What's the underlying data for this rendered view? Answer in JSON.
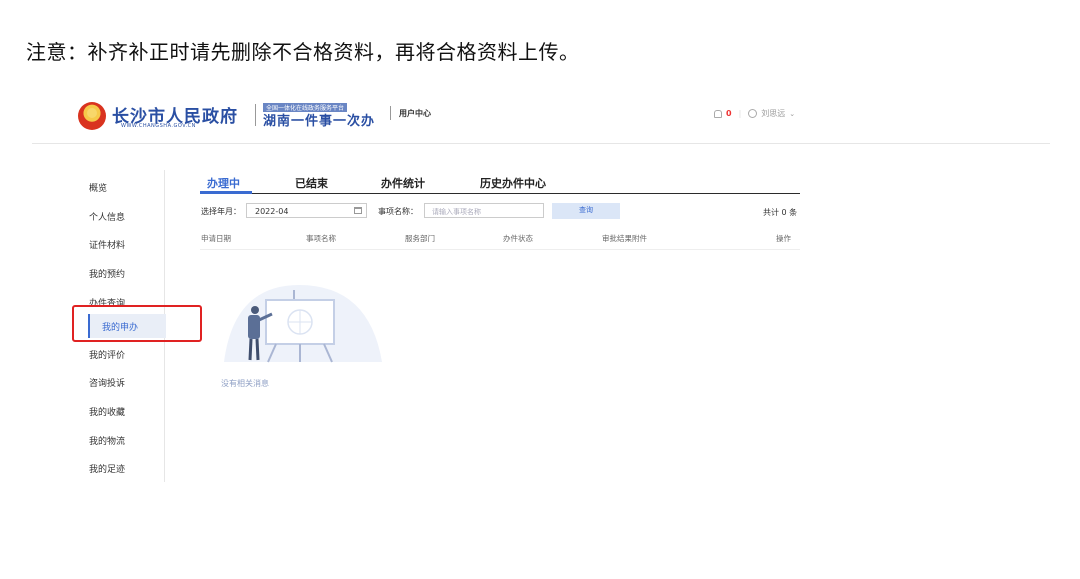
{
  "notice": "注意：补齐补正时请先删除不合格资料，再将合格资料上传。",
  "header": {
    "logo_title": "长沙市人民政府",
    "logo_url": "WWW.CHANGSHA.GOV.CN",
    "brand_top": "全国一体化在线政务服务平台",
    "brand_main": "湖南一件事一次办",
    "user_center": "用户中心",
    "notification_count": "0",
    "user_name": "刘思远",
    "icons": [
      "emblem-icon",
      "bell-icon",
      "user-icon",
      "chevron-down-icon"
    ]
  },
  "sidebar": {
    "items": [
      {
        "label": "概览"
      },
      {
        "label": "个人信息"
      },
      {
        "label": "证件材料"
      },
      {
        "label": "我的预约"
      },
      {
        "label": "办件查询"
      },
      {
        "label": "我的申办"
      },
      {
        "label": "我的评价"
      },
      {
        "label": "咨询投诉"
      },
      {
        "label": "我的收藏"
      },
      {
        "label": "我的物流"
      },
      {
        "label": "我的足迹"
      }
    ],
    "active": "我的申办",
    "highlight_color": "#e02222",
    "accent_color": "#3a6bd1"
  },
  "tabs": [
    {
      "label": "办理中",
      "active": true
    },
    {
      "label": "已结束",
      "active": false
    },
    {
      "label": "办件统计",
      "active": false
    },
    {
      "label": "历史办件中心",
      "active": false
    }
  ],
  "filters": {
    "date_label": "选择年月：",
    "date_value": "2022-04",
    "name_label": "事项名称：",
    "name_placeholder": "请输入事项名称",
    "query_button": "查询",
    "total": "共计 0 条"
  },
  "table": {
    "columns": [
      "申请日期",
      "事项名称",
      "服务部门",
      "办件状态",
      "审批结果附件",
      "操作"
    ],
    "rows": []
  },
  "empty_state": {
    "text": "没有相关消息"
  }
}
